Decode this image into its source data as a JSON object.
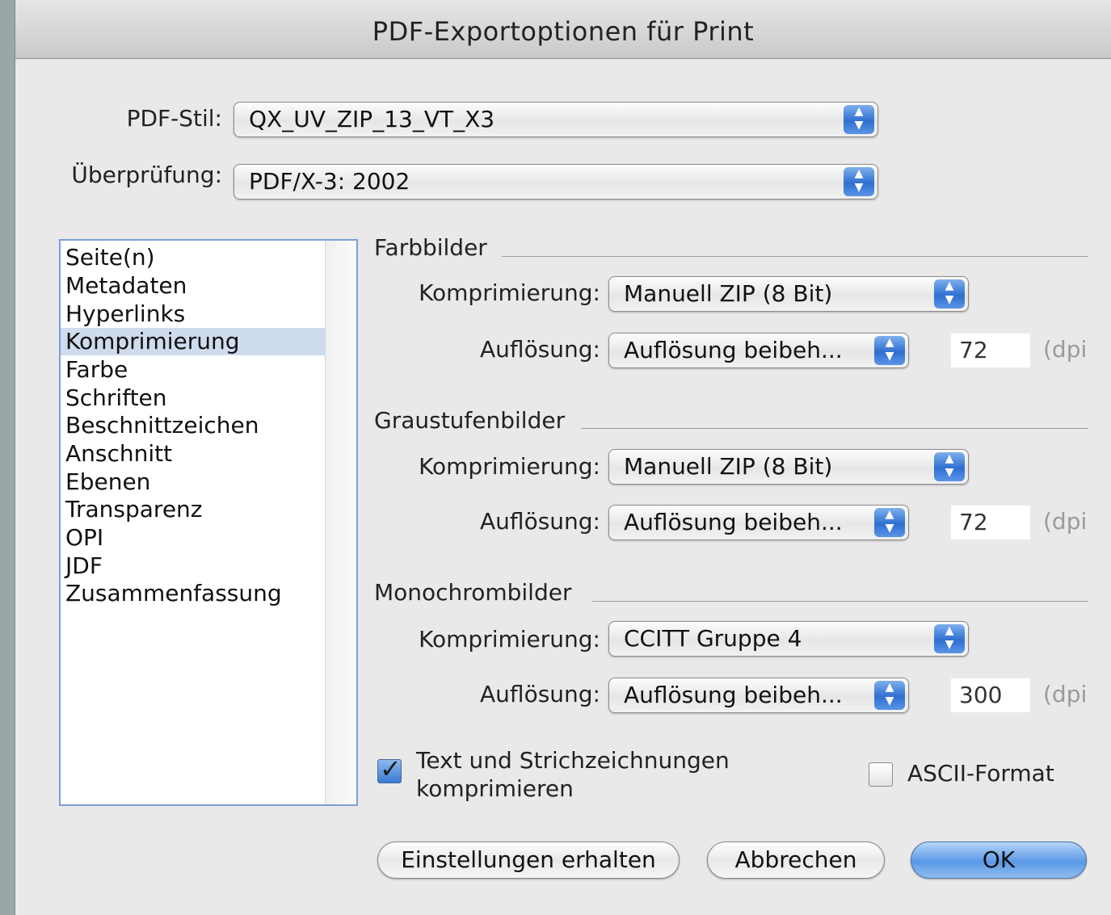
{
  "window": {
    "title": "PDF-Exportoptionen für Print"
  },
  "top": {
    "pdf_style_label": "PDF-Stil:",
    "pdf_style_value": "QX_UV_ZIP_13_VT_X3",
    "verification_label": "Überprüfung:",
    "verification_value": "PDF/X-3: 2002"
  },
  "sidebar": {
    "items": [
      "Seite(n)",
      "Metadaten",
      "Hyperlinks",
      "Komprimierung",
      "Farbe",
      "Schriften",
      "Beschnittzeichen",
      "Anschnitt",
      "Ebenen",
      "Transparenz",
      "OPI",
      "JDF",
      "Zusammenfassung"
    ],
    "selected": "Komprimierung"
  },
  "sections": {
    "color": {
      "title": "Farbbilder",
      "compression_label": "Komprimierung:",
      "compression_value": "Manuell ZIP (8 Bit)",
      "resolution_label": "Auflösung:",
      "resolution_value": "Auflösung beibeh...",
      "dpi_value": "72",
      "dpi_unit": "(dpi"
    },
    "gray": {
      "title": "Graustufenbilder",
      "compression_label": "Komprimierung:",
      "compression_value": "Manuell ZIP (8 Bit)",
      "resolution_label": "Auflösung:",
      "resolution_value": "Auflösung beibeh...",
      "dpi_value": "72",
      "dpi_unit": "(dpi"
    },
    "mono": {
      "title": "Monochrombilder",
      "compression_label": "Komprimierung:",
      "compression_value": "CCITT Gruppe 4",
      "resolution_label": "Auflösung:",
      "resolution_value": "Auflösung beibeh...",
      "dpi_value": "300",
      "dpi_unit": "(dpi"
    }
  },
  "options": {
    "compress_text_line1": "Text und Strichzeichnungen",
    "compress_text_line2": "komprimieren",
    "compress_text_checked": true,
    "ascii_label": "ASCII-Format",
    "ascii_checked": false
  },
  "buttons": {
    "keep_settings": "Einstellungen erhalten",
    "cancel": "Abbrechen",
    "ok": "OK"
  },
  "colors": {
    "accent": "#3a79d4",
    "selection": "#cfdcee"
  }
}
